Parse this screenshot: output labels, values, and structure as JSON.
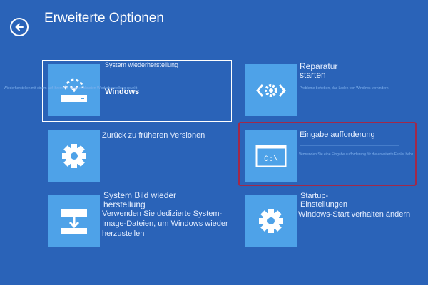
{
  "header": {
    "title": "Erweiterte Optionen",
    "back_icon": "back-arrow-icon"
  },
  "colors": {
    "background": "#2a63b8",
    "tile": "#4ea2e8",
    "focus_outline": "#a0294a",
    "text": "#ffffff"
  },
  "options": [
    {
      "id": "system-restore",
      "icon": "restore-drive-icon",
      "label": "System wiederherstellung",
      "sublabel": "Windows",
      "description": "Wiederherstellen mit einem auf Ihrem PC aufgezeichneten Wiederherstellung spunkt"
    },
    {
      "id": "startup-repair",
      "icon": "code-gear-icon",
      "label": "Reparatur starten",
      "description": "Probleme beheben, das Laden von Windows verhindern"
    },
    {
      "id": "previous-version",
      "icon": "gear-icon",
      "label": "Zurück zu früheren Versionen"
    },
    {
      "id": "command-prompt",
      "icon": "command-prompt-icon",
      "label": "Eingabe aufforderung",
      "icon_text": "C:\\",
      "description": "Verwenden Sie eine Eingabe aufforderung für die erweiterte Fehler behebung"
    },
    {
      "id": "system-image",
      "icon": "download-drive-icon",
      "label": "System Bild wieder herstellung",
      "description": "Verwenden Sie dedizierte System-Image-Dateien, um Windows wieder herzustellen"
    },
    {
      "id": "startup-settings",
      "icon": "gear-icon",
      "label": "Startup-Einstellungen",
      "description": "Windows-Start verhalten ändern"
    }
  ]
}
